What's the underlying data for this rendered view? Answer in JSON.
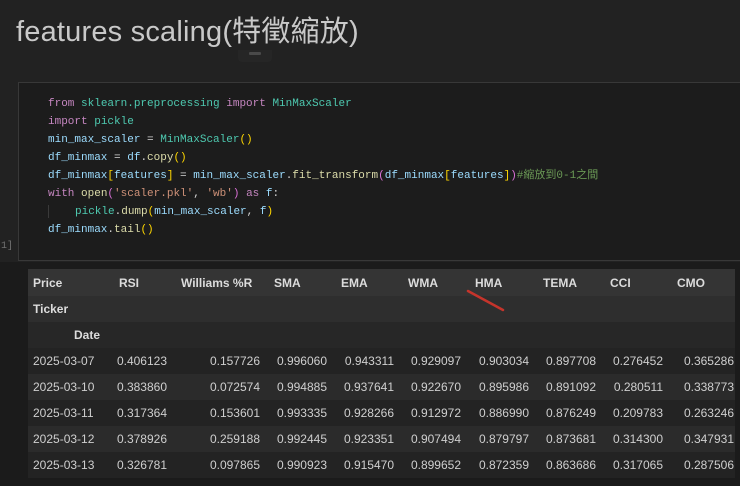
{
  "page": {
    "title": "features scaling(特徵縮放)"
  },
  "cell": {
    "execution_label": "1]"
  },
  "code": {
    "palette": {
      "kw": "#C586C0",
      "mod": "#4EC9B0",
      "var": "#9CDCFE",
      "fn": "#DCDCAA",
      "pun": "#D4D4D4",
      "b1": "#FFD700",
      "b2": "#DA70D6",
      "str": "#CE9178",
      "com": "#6A9955"
    },
    "lines": [
      [
        {
          "t": "from ",
          "c": "kw"
        },
        {
          "t": "sklearn.preprocessing",
          "c": "mod"
        },
        {
          "t": " import ",
          "c": "kw"
        },
        {
          "t": "MinMaxScaler",
          "c": "mod"
        }
      ],
      [
        {
          "t": "import ",
          "c": "kw"
        },
        {
          "t": "pickle",
          "c": "mod"
        }
      ],
      [
        {
          "t": "min_max_scaler",
          "c": "var"
        },
        {
          "t": " = ",
          "c": "pun"
        },
        {
          "t": "MinMaxScaler",
          "c": "mod"
        },
        {
          "t": "()",
          "c": "b1"
        }
      ],
      [
        {
          "t": "df_minmax",
          "c": "var"
        },
        {
          "t": " = ",
          "c": "pun"
        },
        {
          "t": "df",
          "c": "var"
        },
        {
          "t": ".",
          "c": "pun"
        },
        {
          "t": "copy",
          "c": "fn"
        },
        {
          "t": "()",
          "c": "b1"
        }
      ],
      [
        {
          "t": "df_minmax",
          "c": "var"
        },
        {
          "t": "[",
          "c": "b1"
        },
        {
          "t": "features",
          "c": "var"
        },
        {
          "t": "]",
          "c": "b1"
        },
        {
          "t": " = ",
          "c": "pun"
        },
        {
          "t": "min_max_scaler",
          "c": "var"
        },
        {
          "t": ".",
          "c": "pun"
        },
        {
          "t": "fit_transform",
          "c": "fn"
        },
        {
          "t": "(",
          "c": "b2"
        },
        {
          "t": "df_minmax",
          "c": "var"
        },
        {
          "t": "[",
          "c": "b1"
        },
        {
          "t": "features",
          "c": "var"
        },
        {
          "t": "]",
          "c": "b1"
        },
        {
          "t": ")",
          "c": "b2"
        },
        {
          "t": "#縮放到0-1之間",
          "c": "com"
        }
      ],
      [
        {
          "t": "with ",
          "c": "kw"
        },
        {
          "t": "open",
          "c": "fn"
        },
        {
          "t": "(",
          "c": "b2"
        },
        {
          "t": "'scaler.pkl'",
          "c": "str"
        },
        {
          "t": ", ",
          "c": "pun"
        },
        {
          "t": "'wb'",
          "c": "str"
        },
        {
          "t": ")",
          "c": "b2"
        },
        {
          "t": " as ",
          "c": "kw"
        },
        {
          "t": "f",
          "c": "var"
        },
        {
          "t": ":",
          "c": "pun"
        }
      ],
      [
        {
          "t": "",
          "c": "guide"
        },
        {
          "t": "pickle",
          "c": "mod"
        },
        {
          "t": ".",
          "c": "pun"
        },
        {
          "t": "dump",
          "c": "fn"
        },
        {
          "t": "(",
          "c": "b1"
        },
        {
          "t": "min_max_scaler",
          "c": "var"
        },
        {
          "t": ", ",
          "c": "pun"
        },
        {
          "t": "f",
          "c": "var"
        },
        {
          "t": ")",
          "c": "b1"
        }
      ],
      [
        {
          "t": "df_minmax",
          "c": "var"
        },
        {
          "t": ".",
          "c": "pun"
        },
        {
          "t": "tail",
          "c": "fn"
        },
        {
          "t": "()",
          "c": "b1"
        }
      ]
    ]
  },
  "table": {
    "columns": [
      "Price",
      "RSI",
      "Williams %R",
      "SMA",
      "EMA",
      "WMA",
      "HMA",
      "TEMA",
      "CCI",
      "CMO"
    ],
    "index_header": "Ticker",
    "index_name": "Date",
    "rows": [
      [
        "2025-03-07",
        "0.406123",
        "0.157726",
        "0.996060",
        "0.943311",
        "0.929097",
        "0.903034",
        "0.897708",
        "0.276452",
        "0.365286"
      ],
      [
        "2025-03-10",
        "0.383860",
        "0.072574",
        "0.994885",
        "0.937641",
        "0.922670",
        "0.895986",
        "0.891092",
        "0.280511",
        "0.338773"
      ],
      [
        "2025-03-11",
        "0.317364",
        "0.153601",
        "0.993335",
        "0.928266",
        "0.912972",
        "0.886990",
        "0.876249",
        "0.209783",
        "0.263246"
      ],
      [
        "2025-03-12",
        "0.378926",
        "0.259188",
        "0.992445",
        "0.923351",
        "0.907494",
        "0.879797",
        "0.873681",
        "0.314300",
        "0.347931"
      ],
      [
        "2025-03-13",
        "0.326781",
        "0.097865",
        "0.990923",
        "0.915470",
        "0.899652",
        "0.872359",
        "0.863686",
        "0.317065",
        "0.287506"
      ]
    ]
  },
  "annotation": {
    "name": "red-pen-stroke",
    "color": "#C5342B"
  }
}
